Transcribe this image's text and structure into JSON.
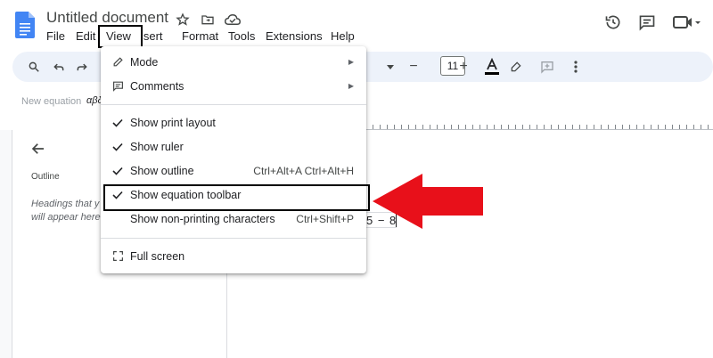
{
  "document": {
    "title": "Untitled document"
  },
  "menubar": {
    "items": [
      "File",
      "Edit",
      "View",
      "Insert",
      "Format",
      "Tools",
      "Extensions",
      "Help"
    ]
  },
  "toolbar": {
    "font_size": "11",
    "minus": "−",
    "plus": "+"
  },
  "equation_toolbar": {
    "new_equation_label": "New equation",
    "greek_label": "αβδ"
  },
  "outline": {
    "title": "Outline",
    "hint_line1": "Headings that y",
    "hint_line2": "will appear here"
  },
  "page": {
    "equation_text": "5 − 8"
  },
  "view_menu": {
    "items": [
      {
        "label": "Mode",
        "checked": false,
        "shortcut": "",
        "submenu": true,
        "icon": "pencil-icon"
      },
      {
        "label": "Comments",
        "checked": false,
        "shortcut": "",
        "submenu": true,
        "icon": "comment-icon"
      },
      {
        "label": "Show print layout",
        "checked": true,
        "shortcut": "",
        "submenu": false
      },
      {
        "label": "Show ruler",
        "checked": true,
        "shortcut": "",
        "submenu": false
      },
      {
        "label": "Show outline",
        "checked": true,
        "shortcut": "Ctrl+Alt+A Ctrl+Alt+H",
        "submenu": false
      },
      {
        "label": "Show equation toolbar",
        "checked": true,
        "shortcut": "",
        "submenu": false
      },
      {
        "label": "Show non-printing characters",
        "checked": false,
        "shortcut": "Ctrl+Shift+P",
        "submenu": false
      },
      {
        "label": "Full screen",
        "checked": false,
        "shortcut": "",
        "submenu": false,
        "icon": "fullscreen-icon"
      }
    ]
  },
  "colors": {
    "docs_blue": "#4285f4",
    "toolbar_bg": "#edf2fa",
    "annotation_red": "#e8101a"
  }
}
